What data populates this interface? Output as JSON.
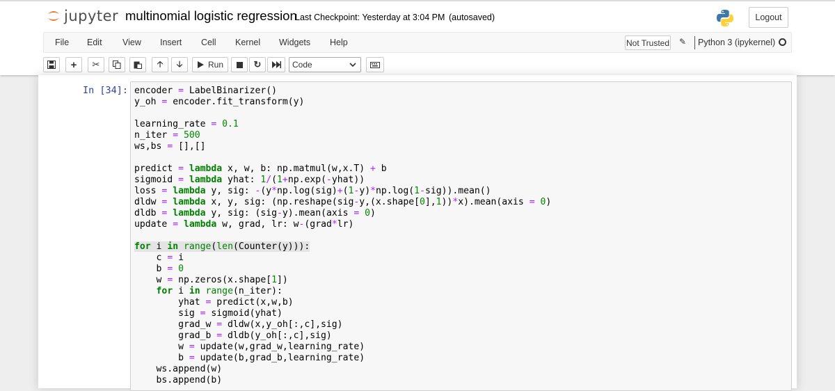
{
  "header": {
    "logo_text": "jupyter",
    "notebook_name": "multinomial logistic regression",
    "checkpoint": "Last Checkpoint: Yesterday at 3:04 PM",
    "autosave": "(autosaved)",
    "logout_label": "Logout"
  },
  "menubar": {
    "items": [
      "File",
      "Edit",
      "View",
      "Insert",
      "Cell",
      "Kernel",
      "Widgets",
      "Help"
    ],
    "trust_label": "Not Trusted",
    "kernel_name": "Python 3 (ipykernel)"
  },
  "toolbar": {
    "run_label": "Run",
    "cell_type": "Code",
    "icons": [
      "save-icon",
      "plus-icon",
      "cut-icon",
      "copy-icon",
      "paste-icon",
      "arrow-up-icon",
      "arrow-down-icon",
      "play-icon",
      "stop-icon",
      "restart-icon",
      "fast-forward-icon",
      "keyboard-icon"
    ]
  },
  "cell": {
    "prompt": "In [34]:",
    "code_lines": [
      "encoder = LabelBinarizer()",
      "y_oh = encoder.fit_transform(y)",
      "",
      "learning_rate = 0.1",
      "n_iter = 500",
      "ws,bs = [],[]",
      "",
      "predict = lambda x, w, b: np.matmul(w,x.T) + b",
      "sigmoid = lambda yhat: 1/(1+np.exp(-yhat))",
      "loss = lambda y, sig: -(y*np.log(sig)+(1-y)*np.log(1-sig)).mean()",
      "dldw = lambda x, y, sig: (np.reshape(sig-y,(x.shape[0],1))*x).mean(axis = 0)",
      "dldb = lambda y, sig: (sig-y).mean(axis = 0)",
      "update = lambda w, grad, lr: w-(grad*lr)",
      "",
      "for i in range(len(Counter(y))):",
      "    c = i",
      "    b = 0",
      "    w = np.zeros(x.shape[1])",
      "    for i in range(n_iter):",
      "        yhat = predict(x,w,b)",
      "        sig = sigmoid(yhat)",
      "        grad_w = dldw(x,y_oh[:,c],sig)",
      "        grad_b = dldb(y_oh[:,c],sig)",
      "        w = update(w,grad_w,learning_rate)",
      "        b = update(b,grad_b,learning_rate)",
      "    ws.append(w)",
      "    bs.append(b)"
    ]
  },
  "colors": {
    "prompt": "#303f9f",
    "keyword": "#008000",
    "operator": "#aa22ff",
    "number": "#008800",
    "logo_orange": "#f37726"
  }
}
